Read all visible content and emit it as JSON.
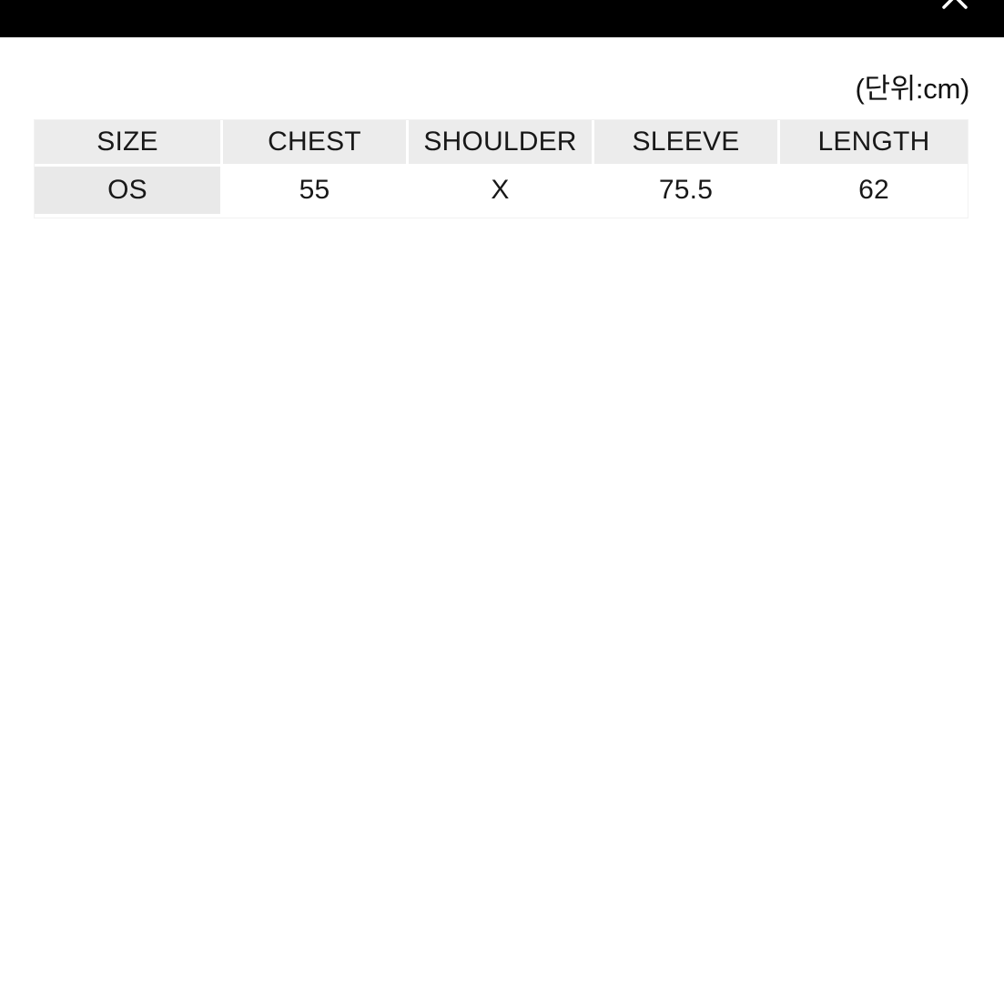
{
  "topbar": {
    "background_color": "#000000",
    "close_icon_label": "close-icon"
  },
  "caption": {
    "unit_note": "(단위:cm)"
  },
  "size_table": {
    "columns": [
      "SIZE",
      "CHEST",
      "SHOULDER",
      "SLEEVE",
      "LENGTH"
    ],
    "rows": [
      {
        "size": "OS",
        "chest": "55",
        "shoulder": "X",
        "sleeve": "75.5",
        "length": "62"
      }
    ],
    "header_bg": "#ececec",
    "size_cell_bg": "#e9e9e9",
    "value_cell_bg": "#ffffff",
    "gridline_color": "#ffffff"
  }
}
